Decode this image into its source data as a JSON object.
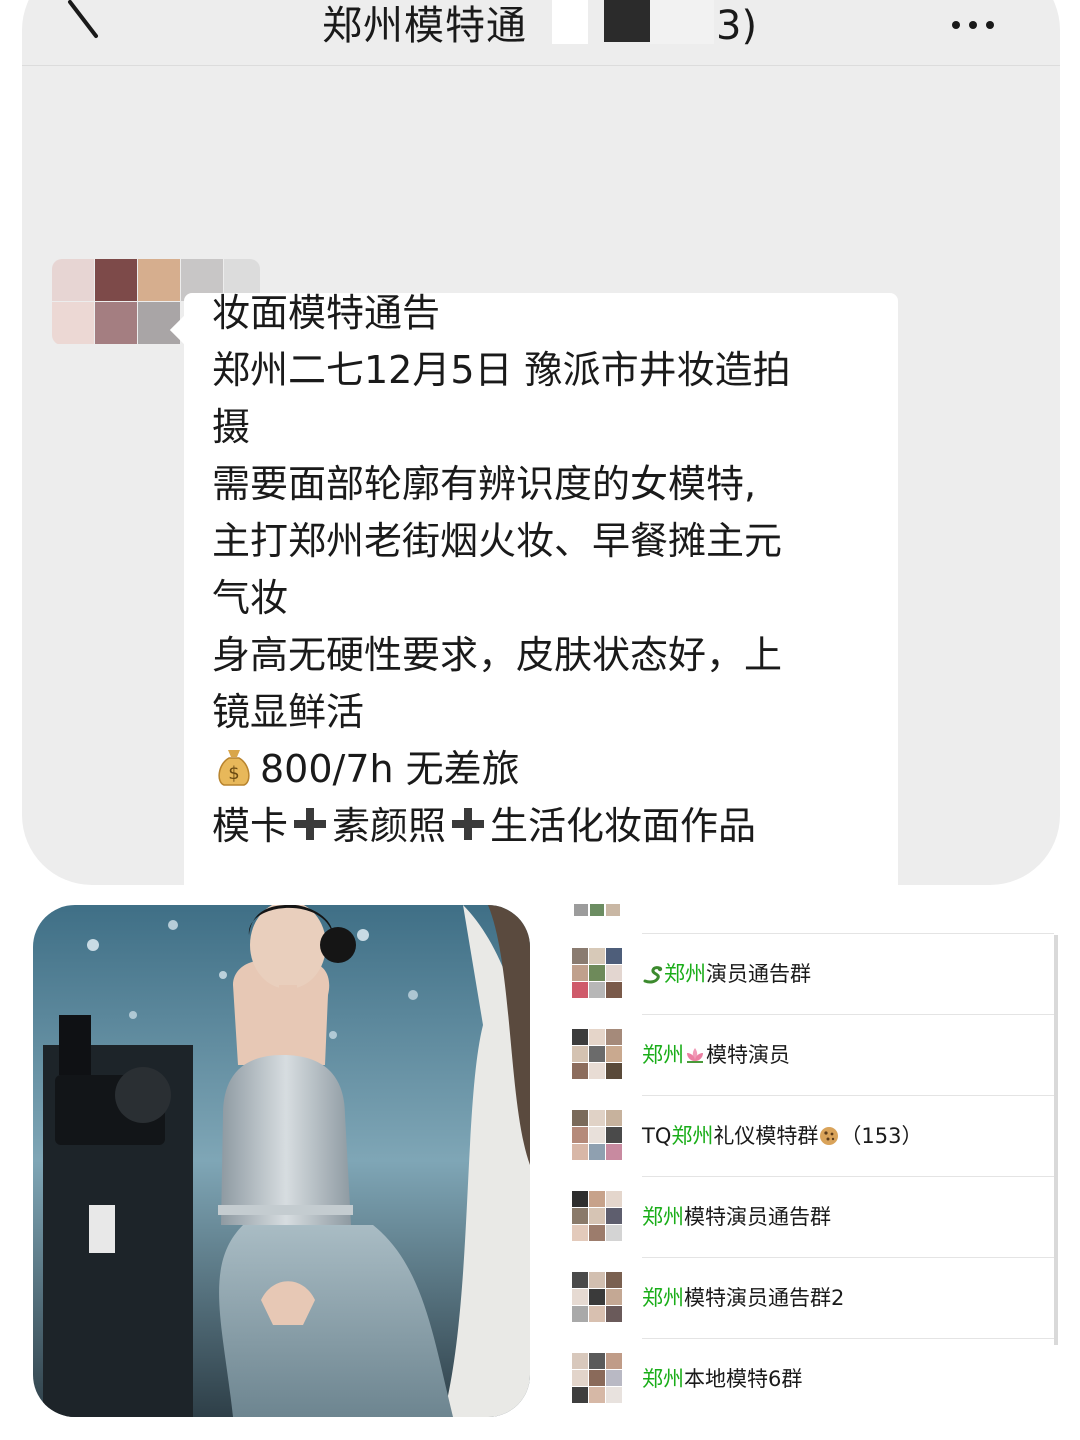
{
  "chat": {
    "title": "郑州模特通",
    "title_suffix": "3)",
    "message": {
      "lines": [
        "妆面模特通告",
        "郑州二七12月5日 豫派市井妆造拍",
        "摄",
        "需要面部轮廓有辨识度的女模特,",
        "主打郑州老街烟火妆、早餐摊主元",
        "气妆",
        "身高无硬性要求，皮肤状态好，上",
        "镜显鲜活"
      ],
      "pay_text": "800/7h 无差旅",
      "requirements": [
        "模卡",
        "素颜照",
        "生活化妆面作品"
      ]
    }
  },
  "groups": [
    {
      "pre": "",
      "highlight": "郑州",
      "mid": "演员通告群",
      "emoji": "snake",
      "emoji_pos": "start",
      "suffix": ""
    },
    {
      "pre": "",
      "highlight": "郑州",
      "mid": "模特演员",
      "emoji": "lotus",
      "emoji_pos": "after-highlight",
      "suffix": ""
    },
    {
      "pre": "TQ",
      "highlight": "郑州",
      "mid": "礼仪模特群",
      "emoji": "cookie",
      "emoji_pos": "end",
      "suffix": "（153）"
    },
    {
      "pre": "",
      "highlight": "郑州",
      "mid": "模特演员通告群",
      "emoji": "",
      "emoji_pos": "",
      "suffix": ""
    },
    {
      "pre": "",
      "highlight": "郑州",
      "mid": "模特演员通告群2",
      "emoji": "",
      "emoji_pos": "",
      "suffix": ""
    },
    {
      "pre": "",
      "highlight": "郑州",
      "mid": "本地模特6群",
      "emoji": "",
      "emoji_pos": "",
      "suffix": ""
    }
  ],
  "colors": {
    "highlight_green": "#1aad19",
    "chat_bg": "#ededed",
    "bubble_bg": "#ffffff"
  },
  "icons": {
    "back": "back-arrow-icon",
    "more": "more-dots-icon",
    "money": "money-bag-icon",
    "plus": "plus-icon"
  }
}
